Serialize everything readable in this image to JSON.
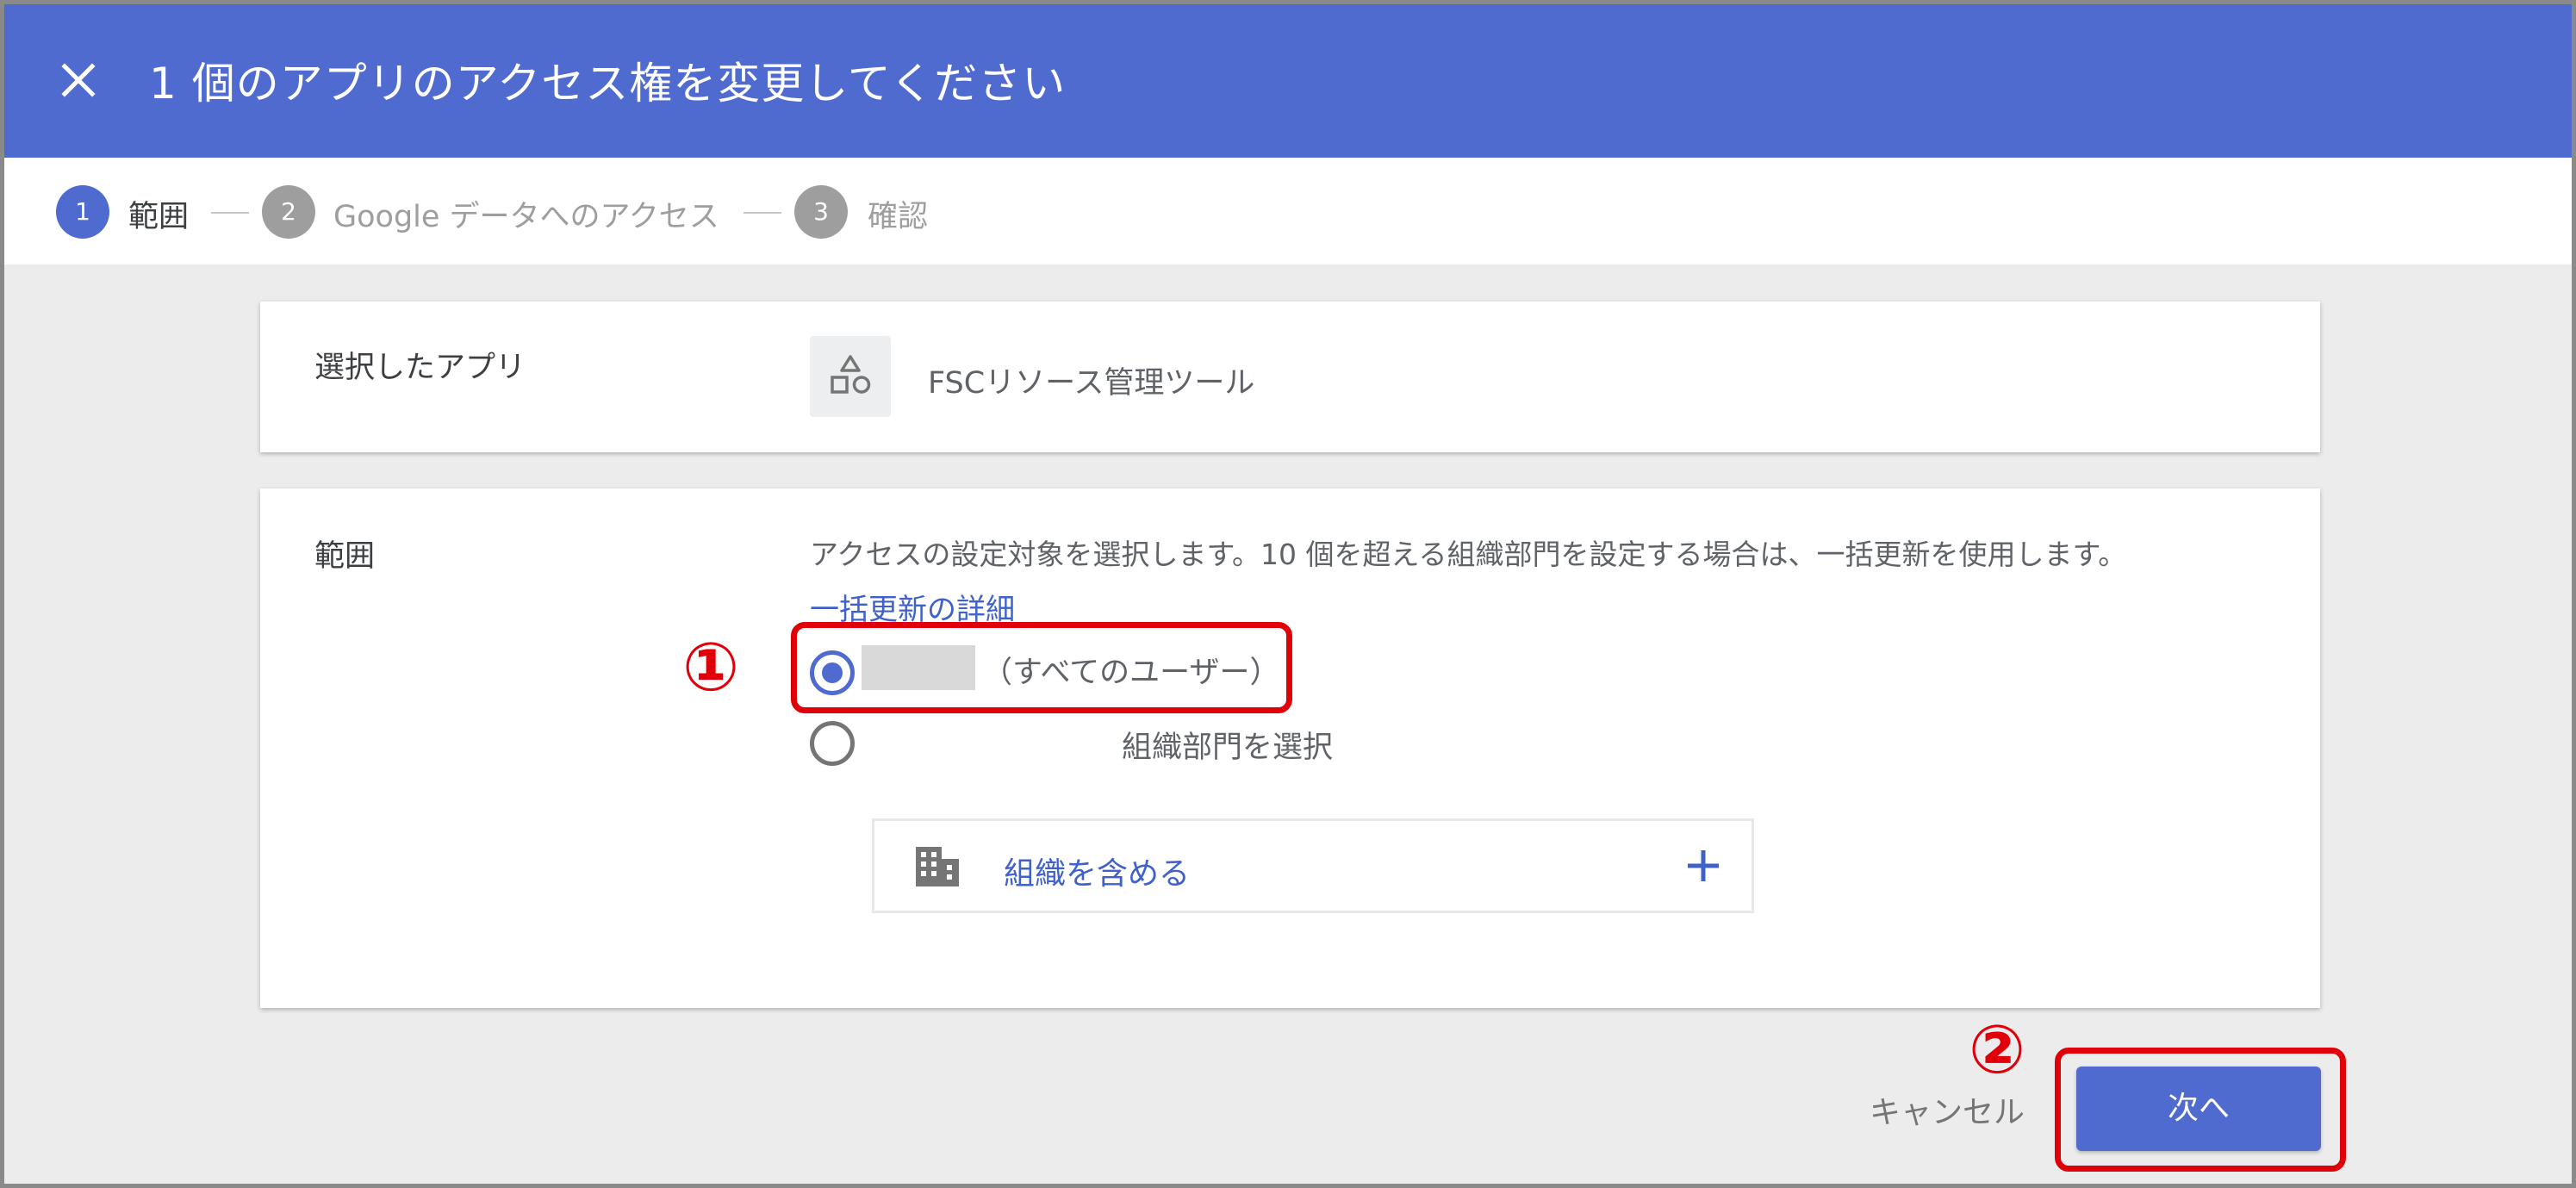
{
  "header": {
    "close_icon": "close-icon",
    "title": "1 個のアプリのアクセス権を変更してください",
    "background_color": "#4f6bd0"
  },
  "stepper": {
    "steps": [
      {
        "number": "1",
        "label": "範囲",
        "state": "active"
      },
      {
        "number": "2",
        "label": "Google データへのアクセス",
        "state": "inactive"
      },
      {
        "number": "3",
        "label": "確認",
        "state": "inactive"
      }
    ],
    "separator": "—"
  },
  "selected_app": {
    "label": "選択したアプリ",
    "app_icon": "shapes-icon",
    "app_name": "FSCリソース管理ツール"
  },
  "scope": {
    "label": "範囲",
    "description": "アクセスの設定対象を選択します。10 個を超える組織部門を設定する場合は、一括更新を使用します。",
    "link_text": "一括更新の詳細",
    "options": [
      {
        "label": "（すべてのユーザー）",
        "checked": true
      },
      {
        "label": "組織部門を選択",
        "checked": false
      }
    ],
    "include_org": {
      "icon": "building-icon",
      "label": "組織を含める",
      "action_icon": "plus-icon"
    }
  },
  "footer": {
    "cancel_label": "キャンセル",
    "next_label": "次へ"
  },
  "annotations": {
    "callout_1": "①",
    "callout_2": "②",
    "highlight_color": "#e0000a"
  }
}
